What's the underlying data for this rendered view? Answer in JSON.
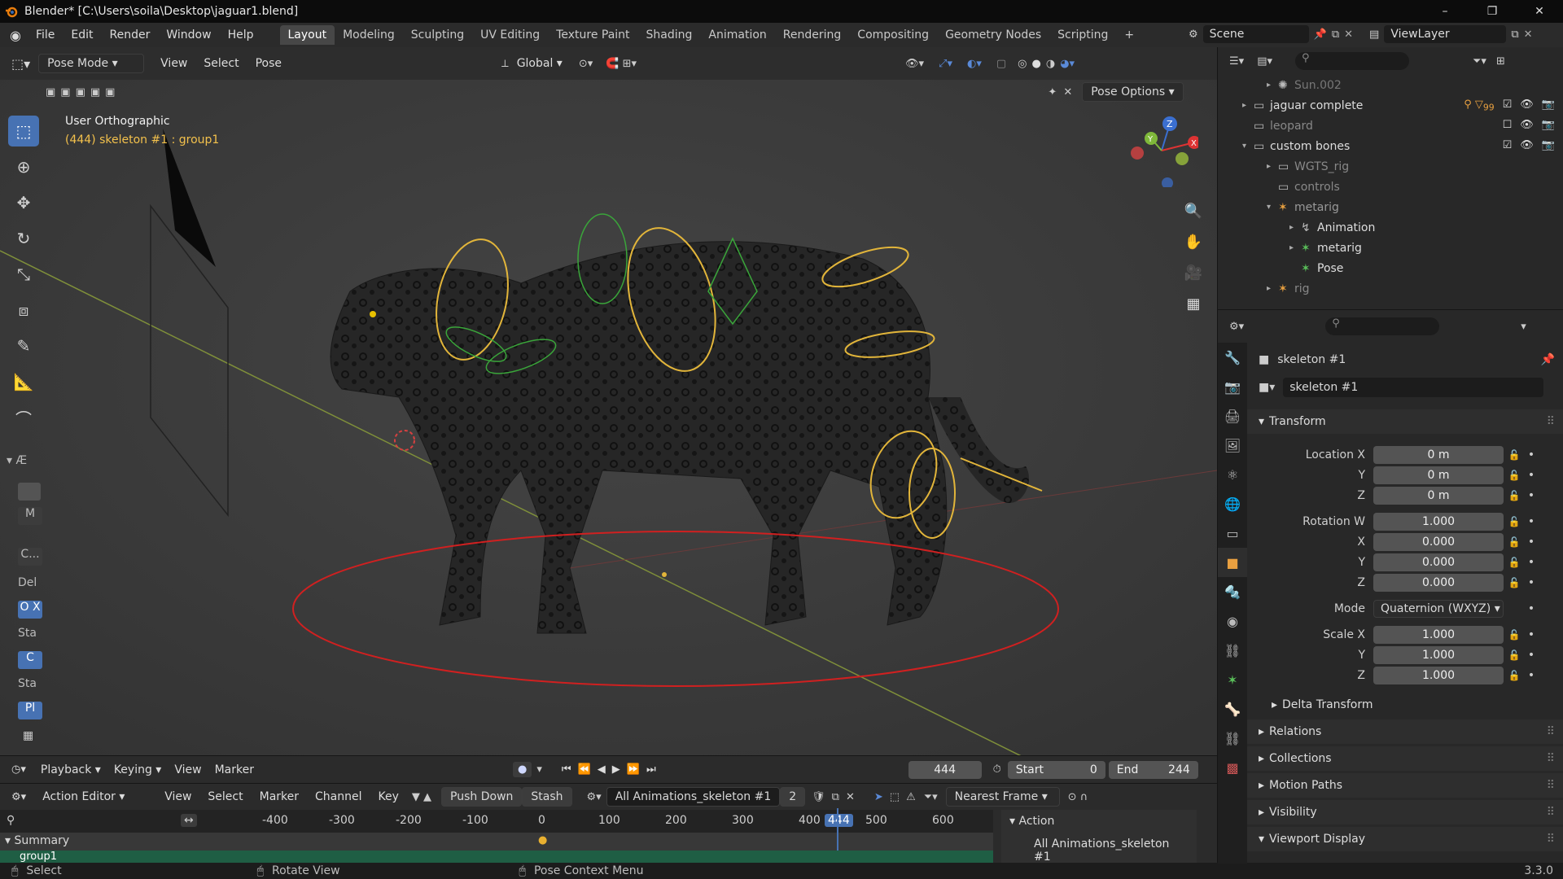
{
  "window": {
    "title": "Blender* [C:\\Users\\soila\\Desktop\\jaguar1.blend]",
    "controls": [
      "–",
      "❐",
      "✕"
    ]
  },
  "menu": [
    "File",
    "Edit",
    "Render",
    "Window",
    "Help"
  ],
  "workspaces": [
    "Layout",
    "Modeling",
    "Sculpting",
    "UV Editing",
    "Texture Paint",
    "Shading",
    "Animation",
    "Rendering",
    "Compositing",
    "Geometry Nodes",
    "Scripting"
  ],
  "active_workspace": "Layout",
  "scene_name": "Scene",
  "view_layer": "ViewLayer",
  "viewport": {
    "mode": "Pose Mode",
    "menus": [
      "View",
      "Select",
      "Pose"
    ],
    "transform_orientation": "Global",
    "pose_options": "Pose Options",
    "view_name": "User Orthographic",
    "context": "(444) skeleton #1 : group1"
  },
  "sidebar_tabs": [
    "Del",
    "Sta",
    "Sta"
  ],
  "sidebar_buttons": [
    "M",
    "C...",
    "O X",
    "C",
    "Pl"
  ],
  "sidebar_heading": "Æ",
  "timeline": {
    "menus": [
      "Playback",
      "Keying",
      "View",
      "Marker"
    ],
    "current_frame": "444",
    "start_label": "Start",
    "start": "0",
    "end_label": "End",
    "end": "244"
  },
  "action_editor": {
    "mode": "Action Editor",
    "menus": [
      "View",
      "Select",
      "Marker",
      "Channel",
      "Key"
    ],
    "push_down": "Push Down",
    "stash": "Stash",
    "action_name": "All Animations_skeleton #1",
    "users": "2",
    "snapping": "Nearest Frame",
    "ruler": [
      "-400",
      "-300",
      "-200",
      "-100",
      "0",
      "100",
      "200",
      "300",
      "400",
      "444",
      "500",
      "600"
    ],
    "summary": "Summary",
    "group": "group1",
    "panel_title": "Action",
    "panel_action": "All Animations_skeleton #1"
  },
  "statusbar": {
    "select": "Select",
    "rotate": "Rotate View",
    "context": "Pose Context Menu",
    "version": "3.3.0"
  },
  "outliner": {
    "rows": [
      {
        "label": "Sun.002",
        "dim": true
      },
      {
        "label": "jaguar complete",
        "dim": false
      },
      {
        "label": "leopard",
        "dim": true
      },
      {
        "label": "custom bones",
        "dim": false
      },
      {
        "label": "WGTS_rig",
        "dim": true
      },
      {
        "label": "controls",
        "dim": true
      },
      {
        "label": "metarig",
        "dim": true
      },
      {
        "label": "Animation",
        "dim": false
      },
      {
        "label": "metarig",
        "dim": false
      },
      {
        "label": "Pose",
        "dim": false
      },
      {
        "label": "rig",
        "dim": true
      }
    ],
    "badge": "99"
  },
  "properties": {
    "object_name": "skeleton #1",
    "data_name": "skeleton #1",
    "transform": "Transform",
    "location_label": "Location X",
    "rotation_label": "Rotation W",
    "scale_label": "Scale X",
    "y": "Y",
    "z": "Z",
    "x": "X",
    "location": [
      "0 m",
      "0 m",
      "0 m"
    ],
    "rotation": [
      "1.000",
      "0.000",
      "0.000",
      "0.000"
    ],
    "mode_label": "Mode",
    "mode": "Quaternion (WXYZ)",
    "scale": [
      "1.000",
      "1.000",
      "1.000"
    ],
    "panels": [
      "Delta Transform",
      "Relations",
      "Collections",
      "Motion Paths",
      "Visibility",
      "Viewport Display"
    ]
  }
}
